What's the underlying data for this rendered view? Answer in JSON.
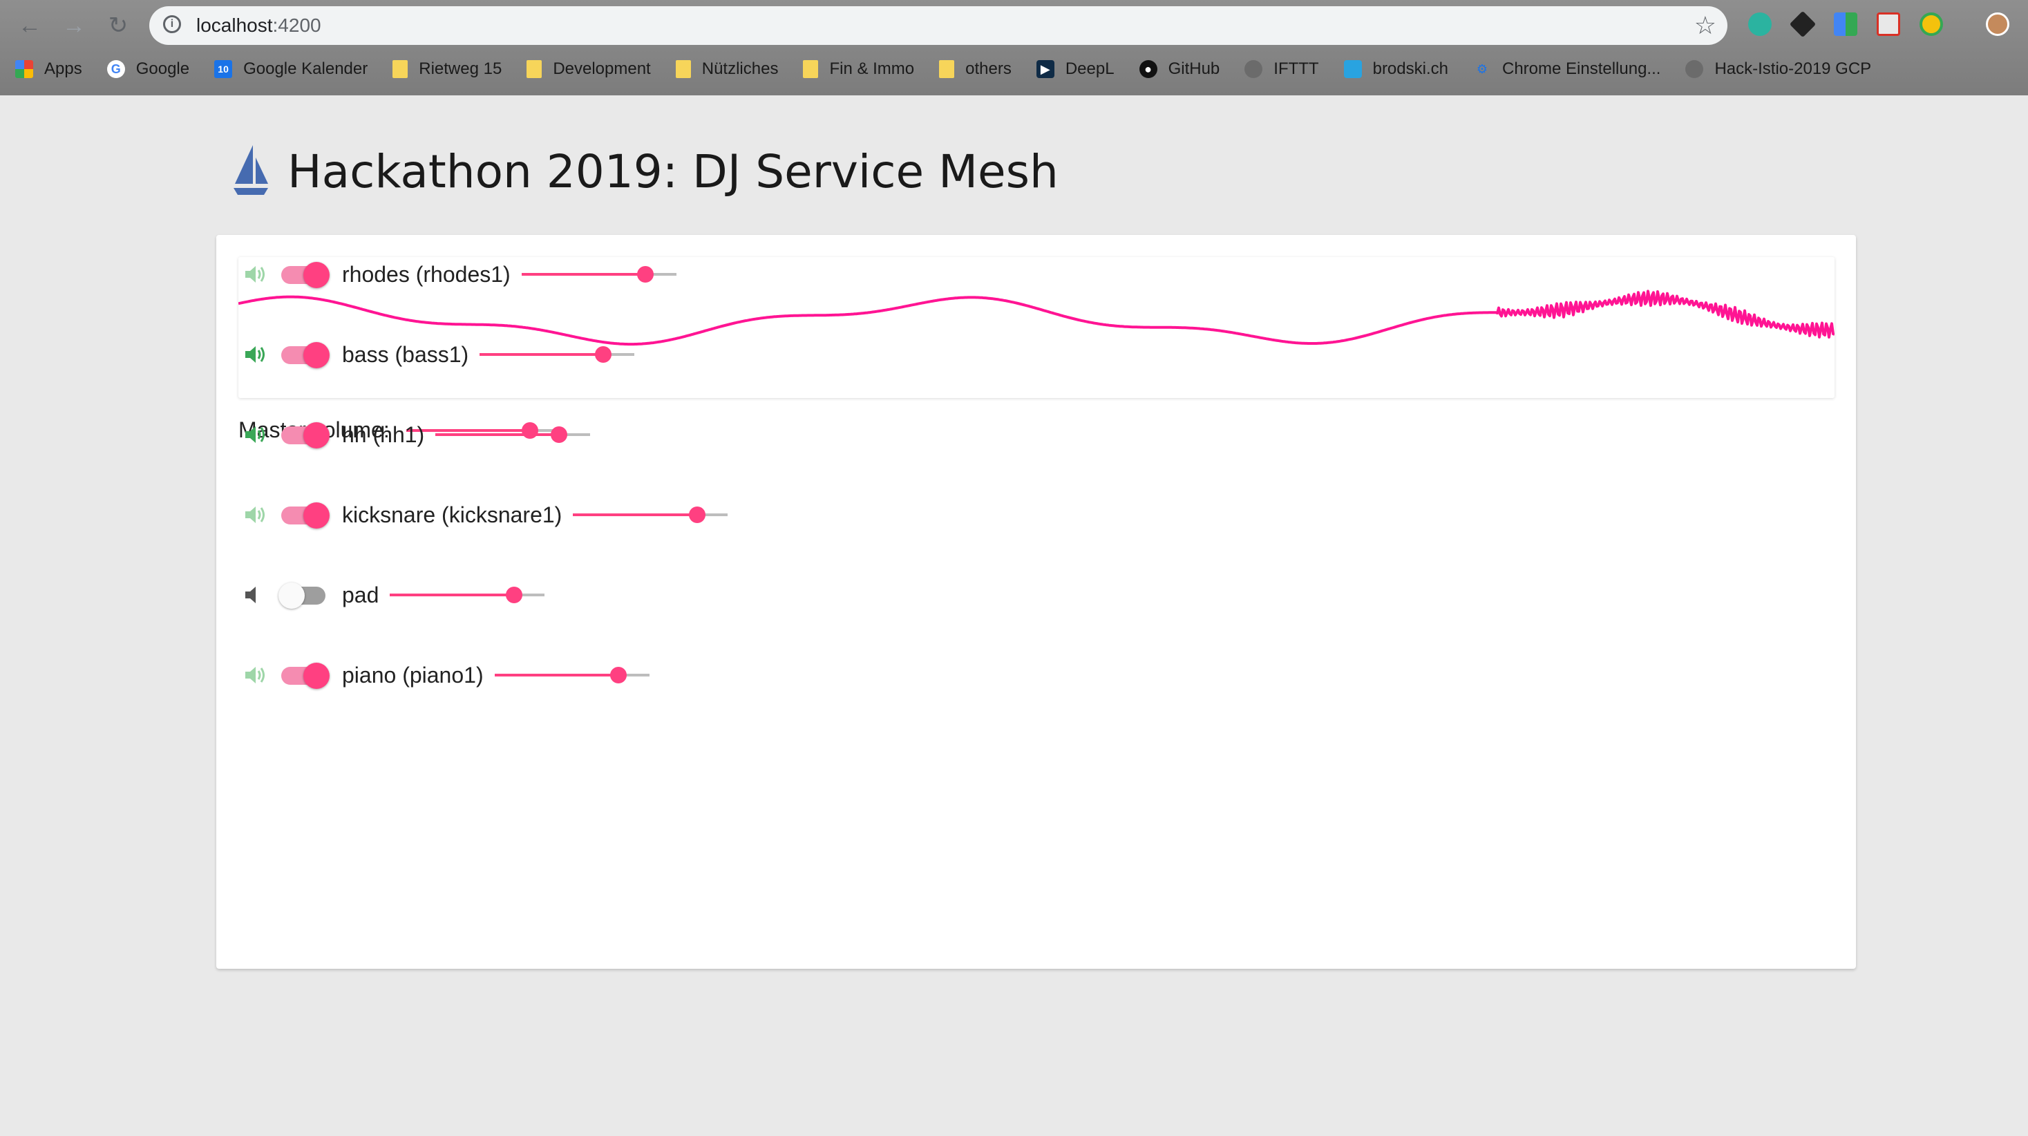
{
  "browser": {
    "url_host": "localhost",
    "url_port": ":4200",
    "bookmarks": [
      {
        "label": "Apps",
        "icon": "apps-grid-icon"
      },
      {
        "label": "Google",
        "icon": "google-icon"
      },
      {
        "label": "Google Kalender",
        "icon": "calendar-icon"
      },
      {
        "label": "Rietweg 15",
        "icon": "folder-icon"
      },
      {
        "label": "Development",
        "icon": "folder-icon"
      },
      {
        "label": "Nützliches",
        "icon": "folder-icon"
      },
      {
        "label": "Fin & Immo",
        "icon": "folder-icon"
      },
      {
        "label": "others",
        "icon": "folder-icon"
      },
      {
        "label": "DeepL",
        "icon": "deepl-icon"
      },
      {
        "label": "GitHub",
        "icon": "github-icon"
      },
      {
        "label": "IFTTT",
        "icon": "globe-icon"
      },
      {
        "label": "brodski.ch",
        "icon": "site-icon"
      },
      {
        "label": "Chrome Einstellung...",
        "icon": "gear-icon"
      },
      {
        "label": "Hack-Istio-2019 GCP",
        "icon": "globe-icon"
      }
    ],
    "calendar_icon_text": "10"
  },
  "page": {
    "title": "Hackathon 2019: DJ Service Mesh",
    "waveform_color": "#ff1493"
  },
  "master": {
    "label": "Master volume:",
    "value": 0.8
  },
  "channels": [
    {
      "label": "rhodes (rhodes1)",
      "enabled": true,
      "speaker_state": "playing-faded",
      "volume": 0.8
    },
    {
      "label": "bass (bass1)",
      "enabled": true,
      "speaker_state": "playing",
      "volume": 0.8
    },
    {
      "label": "hh (hh1)",
      "enabled": true,
      "speaker_state": "playing",
      "volume": 0.8
    },
    {
      "label": "kicksnare (kicksnare1)",
      "enabled": true,
      "speaker_state": "playing-faded",
      "volume": 0.8
    },
    {
      "label": "pad",
      "enabled": false,
      "speaker_state": "muted",
      "volume": 0.8
    },
    {
      "label": "piano (piano1)",
      "enabled": true,
      "speaker_state": "playing-faded",
      "volume": 0.8
    }
  ],
  "colors": {
    "accent": "#ff4081",
    "speaker_on": "#3aa757",
    "speaker_faded": "#9ed6a8",
    "speaker_off": "#555555"
  }
}
